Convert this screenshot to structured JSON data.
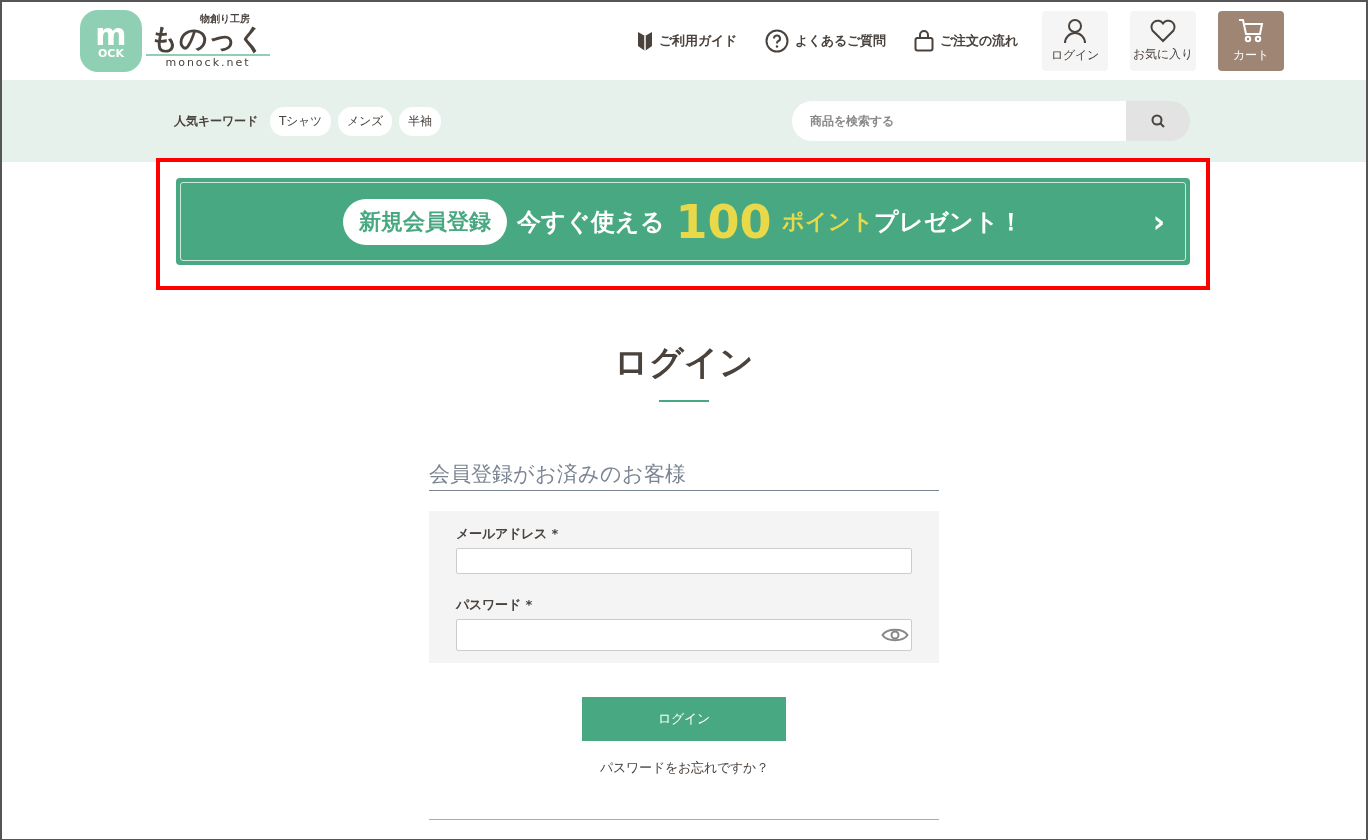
{
  "logo": {
    "badge_top": "m",
    "badge_bottom": "OCK",
    "tagline": "物創り工房",
    "name": "ものっく",
    "domain": "monock.net"
  },
  "nav": [
    {
      "kind": "guide",
      "label": "ご利用ガイド"
    },
    {
      "kind": "faq",
      "label": "よくあるご質問"
    },
    {
      "kind": "order",
      "label": "ご注文の流れ"
    }
  ],
  "header_buttons": [
    {
      "kind": "login",
      "label": "ログイン",
      "selected": false
    },
    {
      "kind": "favorite",
      "label": "お気に入り",
      "selected": false
    },
    {
      "kind": "cart",
      "label": "カート",
      "selected": true
    }
  ],
  "keywords": {
    "label": "人気キーワード",
    "tags": [
      "Tシャツ",
      "メンズ",
      "半袖"
    ]
  },
  "search": {
    "placeholder": "商品を検索する"
  },
  "banner": {
    "highlighted": true,
    "badge": "新規会員登録",
    "lead": "今すぐ使える",
    "number": "100",
    "unit": "ポイント",
    "tail": "プレゼント！",
    "arrow": "›"
  },
  "page_title": "ログイン",
  "section_title": "会員登録がお済みのお客様",
  "fields": [
    {
      "kind": "email",
      "label": "メールアドレス",
      "required_mark": "*"
    },
    {
      "kind": "password",
      "label": "パスワード",
      "required_mark": "*"
    }
  ],
  "submit": "ログイン",
  "forgot_link": "パスワードをお忘れですか？"
}
